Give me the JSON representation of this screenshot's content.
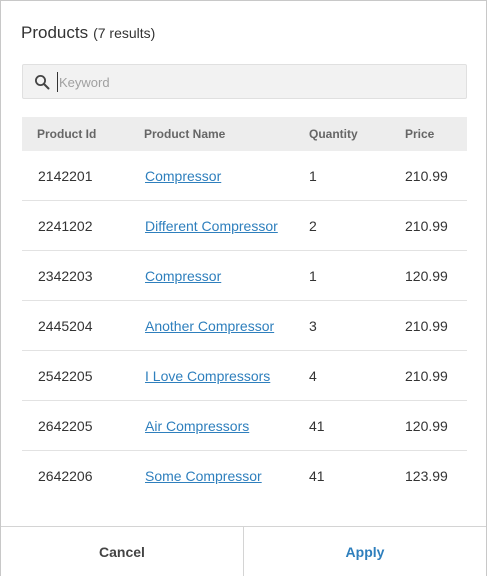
{
  "header": {
    "title": "Products",
    "count": "(7 results)"
  },
  "search": {
    "placeholder": "Keyword",
    "value": "",
    "icon": "search-icon"
  },
  "table": {
    "columns": [
      "Product Id",
      "Product Name",
      "Quantity",
      "Price"
    ],
    "rows": [
      {
        "id": "2142201",
        "name": "Compressor",
        "quantity": "1",
        "price": "210.99"
      },
      {
        "id": "2241202",
        "name": "Different Compressor",
        "quantity": "2",
        "price": "210.99"
      },
      {
        "id": "2342203",
        "name": "Compressor",
        "quantity": "1",
        "price": "120.99"
      },
      {
        "id": "2445204",
        "name": "Another Compressor",
        "quantity": "3",
        "price": "210.99"
      },
      {
        "id": "2542205",
        "name": "I Love Compressors",
        "quantity": "4",
        "price": "210.99"
      },
      {
        "id": "2642205",
        "name": "Air Compressors",
        "quantity": "41",
        "price": "120.99"
      },
      {
        "id": "2642206",
        "name": "Some Compressor",
        "quantity": "41",
        "price": "123.99"
      }
    ]
  },
  "footer": {
    "cancel_label": "Cancel",
    "apply_label": "Apply"
  },
  "colors": {
    "link": "#2e7fbd",
    "header_bg": "#ededed",
    "search_bg": "#f2f2f2"
  }
}
